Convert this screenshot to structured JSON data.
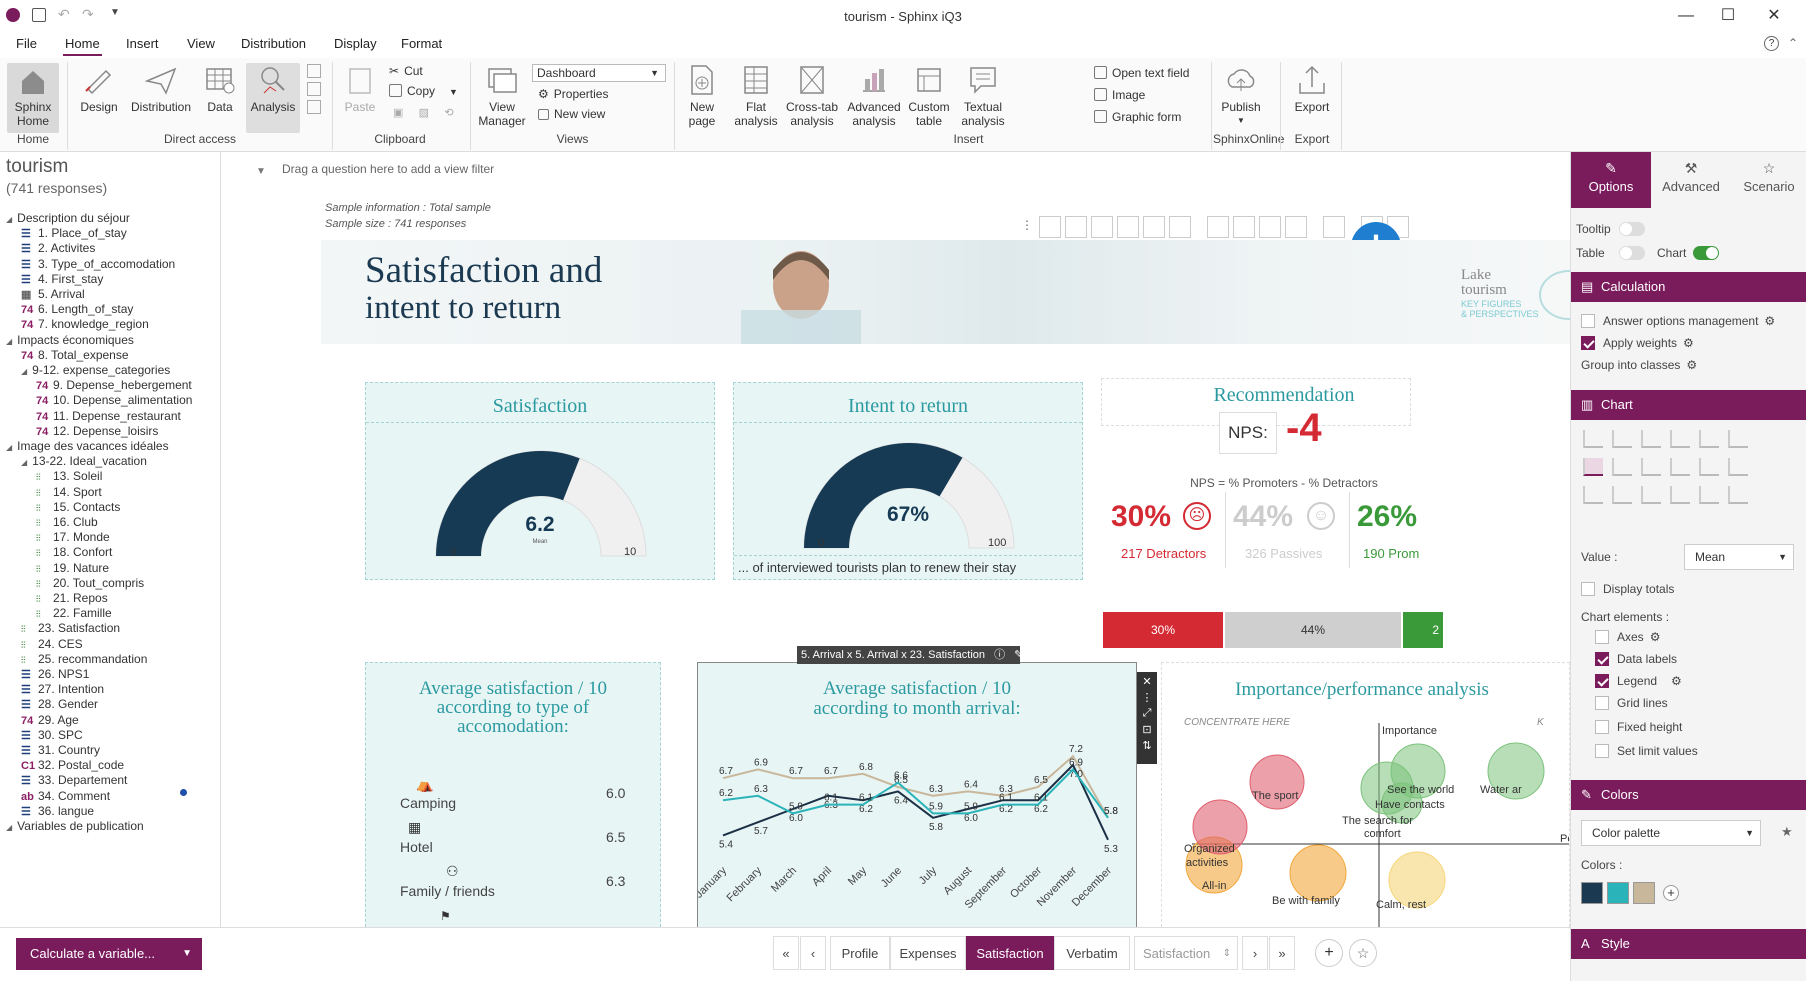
{
  "window": {
    "title": "tourism - Sphinx iQ3"
  },
  "menu": [
    "File",
    "Home",
    "Insert",
    "View",
    "Distribution",
    "Display",
    "Format"
  ],
  "ribbon": {
    "home_btn": [
      "Sphinx",
      "Home"
    ],
    "group_home": "Home",
    "design": "Design",
    "distribution": "Distribution",
    "data": "Data",
    "analysis": "Analysis",
    "group_direct": "Direct access",
    "paste": "Paste",
    "cut": "Cut",
    "copy": "Copy",
    "group_clipboard": "Clipboard",
    "view_manager": [
      "View",
      "Manager"
    ],
    "views_select": "Dashboard",
    "properties": "Properties",
    "new_view": "New view",
    "group_views": "Views",
    "new_page": [
      "New",
      "page"
    ],
    "flat": [
      "Flat",
      "analysis"
    ],
    "crosstab": [
      "Cross-tab",
      "analysis"
    ],
    "advanced": [
      "Advanced",
      "analysis"
    ],
    "custom": [
      "Custom",
      "table"
    ],
    "textual": [
      "Textual",
      "analysis"
    ],
    "open_text": "Open text field",
    "image": "Image",
    "graphic_form": "Graphic form",
    "group_insert": "Insert",
    "publish": "Publish",
    "group_sphinxonline": "SphinxOnline",
    "export": "Export",
    "group_export": "Export"
  },
  "left": {
    "survey": "tourism",
    "responses": "(741 responses)",
    "tree": [
      {
        "t": "Description du séjour",
        "lvl": 0,
        "ic": "tri"
      },
      {
        "t": "1. Place_of_stay",
        "lvl": 1,
        "ic": "list"
      },
      {
        "t": "2. Activites",
        "lvl": 1,
        "ic": "list"
      },
      {
        "t": "3. Type_of_accomodation",
        "lvl": 1,
        "ic": "list"
      },
      {
        "t": "4. First_stay",
        "lvl": 1,
        "ic": "list"
      },
      {
        "t": "5. Arrival",
        "lvl": 1,
        "ic": "cal"
      },
      {
        "t": "6. Length_of_stay",
        "lvl": 1,
        "ic": "num",
        "code": "74"
      },
      {
        "t": "7. knowledge_region",
        "lvl": 1,
        "ic": "num",
        "code": "74"
      },
      {
        "t": "Impacts économiques",
        "lvl": 0,
        "ic": "tri"
      },
      {
        "t": "8. Total_expense",
        "lvl": 1,
        "ic": "num",
        "code": "74"
      },
      {
        "t": "9-12. expense_categories",
        "lvl": 1,
        "ic": "tri"
      },
      {
        "t": "9. Depense_hebergement",
        "lvl": 2,
        "ic": "num",
        "code": "74"
      },
      {
        "t": "10. Depense_alimentation",
        "lvl": 2,
        "ic": "num",
        "code": "74"
      },
      {
        "t": "11. Depense_restaurant",
        "lvl": 2,
        "ic": "num",
        "code": "74"
      },
      {
        "t": "12. Depense_loisirs",
        "lvl": 2,
        "ic": "num",
        "code": "74"
      },
      {
        "t": "Image des vacances idéales",
        "lvl": 0,
        "ic": "tri"
      },
      {
        "t": "13-22. Ideal_vacation",
        "lvl": 1,
        "ic": "tri"
      },
      {
        "t": "13. Soleil",
        "lvl": 2,
        "ic": "scale"
      },
      {
        "t": "14. Sport",
        "lvl": 2,
        "ic": "scale"
      },
      {
        "t": "15. Contacts",
        "lvl": 2,
        "ic": "scale"
      },
      {
        "t": "16. Club",
        "lvl": 2,
        "ic": "scale"
      },
      {
        "t": "17. Monde",
        "lvl": 2,
        "ic": "scale"
      },
      {
        "t": "18. Confort",
        "lvl": 2,
        "ic": "scale"
      },
      {
        "t": "19. Nature",
        "lvl": 2,
        "ic": "scale"
      },
      {
        "t": "20. Tout_compris",
        "lvl": 2,
        "ic": "scale"
      },
      {
        "t": "21. Repos",
        "lvl": 2,
        "ic": "scale"
      },
      {
        "t": "22. Famille",
        "lvl": 2,
        "ic": "scale"
      },
      {
        "t": "23. Satisfaction",
        "lvl": 1,
        "ic": "scale"
      },
      {
        "t": "24. CES",
        "lvl": 1,
        "ic": "scale"
      },
      {
        "t": "25. recommandation",
        "lvl": 1,
        "ic": "scale"
      },
      {
        "t": "26. NPS1",
        "lvl": 1,
        "ic": "list"
      },
      {
        "t": "27. Intention",
        "lvl": 1,
        "ic": "list"
      },
      {
        "t": "28. Gender",
        "lvl": 1,
        "ic": "list"
      },
      {
        "t": "29. Age",
        "lvl": 1,
        "ic": "num",
        "code": "74"
      },
      {
        "t": "30. SPC",
        "lvl": 1,
        "ic": "list"
      },
      {
        "t": "31. Country",
        "lvl": 1,
        "ic": "list"
      },
      {
        "t": "32. Postal_code",
        "lvl": 1,
        "ic": "num",
        "code": "C1"
      },
      {
        "t": "33. Departement",
        "lvl": 1,
        "ic": "list"
      },
      {
        "t": "34. Comment",
        "lvl": 1,
        "ic": "num",
        "code": "ab"
      },
      {
        "t": "36. langue",
        "lvl": 1,
        "ic": "list"
      },
      {
        "t": "Variables de publication",
        "lvl": 0,
        "ic": "tri"
      }
    ],
    "calc_button": "Calculate a variable..."
  },
  "main": {
    "filter_hint": "Drag a question here to add a view filter",
    "sample_info_label": "Sample information : ",
    "sample_info_value": "Total sample",
    "sample_size": "Sample size : 741 responses",
    "banner_title_1": "Satisfaction and",
    "banner_title_2": "intent to return",
    "banner_logo_1": "Lake",
    "banner_logo_2": "tourism",
    "banner_logo_3": "KEY FIGURES",
    "banner_logo_4": "& PERSPECTIVES",
    "sat_title": "Satisfaction",
    "sat_value": "6.2",
    "sat_sub": "Mean",
    "sat_min": "0",
    "sat_max": "10",
    "sat_fraction": 0.62,
    "int_title": "Intent to return",
    "int_value": "67%",
    "int_min": "0",
    "int_max": "100",
    "int_fraction": 0.67,
    "int_caption": "... of interviewed tourists plan to renew their stay",
    "rec_title": "Recommendation",
    "nps_label": "NPS:",
    "nps_value": "-4",
    "nps_formula": "NPS = % Promoters - % Detractors",
    "detractors_pct": "30%",
    "detractors_label": "217 Detractors",
    "passives_pct": "44%",
    "passives_label": "326 Passives",
    "promoters_pct": "26%",
    "promoters_label": "190 Prom",
    "bar_det": "30%",
    "bar_pas": "44%",
    "bar_pro": "2",
    "acc_title": "Average satisfaction / 10 according to type of accomodation:",
    "acc_rows": [
      {
        "label": "Camping",
        "value": "6.0"
      },
      {
        "label": "Hotel",
        "value": "6.5"
      },
      {
        "label": "Family / friends",
        "value": "6.3"
      }
    ],
    "month_tooltip": "5. Arrival x 5. Arrival x 23. Satisfaction",
    "month_title_1": "Average satisfaction / 10",
    "month_title_2": "according to month arrival:",
    "imp_title": "Importance/performance analysis",
    "imp_concentrate": "CONCENTRATE HERE",
    "imp_k": "K",
    "imp_axis": "Importance",
    "imp_per": "Per",
    "bubbles": [
      {
        "label": "The sport",
        "color": "#e06070"
      },
      {
        "label": "See the world",
        "color": "#7cc27c"
      },
      {
        "label": "Have contacts",
        "color": "#7cc27c"
      },
      {
        "label": "Water ar",
        "color": "#7cc27c"
      },
      {
        "label": "The search for",
        "color": ""
      },
      {
        "label": "comfort",
        "color": ""
      },
      {
        "label": "Organized",
        "color": "#f2a73b"
      },
      {
        "label": "activities",
        "color": "#f2a73b"
      },
      {
        "label": "All-in",
        "color": "#e06070"
      },
      {
        "label": "Be with family",
        "color": "#f2a73b"
      },
      {
        "label": "Calm, rest",
        "color": "#f5d67a"
      }
    ]
  },
  "chart_data": {
    "type": "line",
    "title": "Average satisfaction / 10 according to month arrival:",
    "categories": [
      "January",
      "February",
      "March",
      "April",
      "May",
      "June",
      "July",
      "August",
      "September",
      "October",
      "November",
      "December"
    ],
    "series": [
      {
        "values": [
          6.7,
          6.9,
          6.7,
          6.7,
          6.8,
          6.5,
          6.3,
          6.4,
          6.3,
          6.5,
          7.2,
          5.8
        ],
        "color": "#c8b79a"
      },
      {
        "values": [
          5.4,
          5.7,
          6.0,
          6.3,
          6.2,
          6.4,
          5.8,
          6.0,
          6.2,
          6.2,
          7.0,
          5.3
        ],
        "color": "#1b2f45"
      },
      {
        "values": [
          6.2,
          6.3,
          5.9,
          6.1,
          6.1,
          6.6,
          5.9,
          5.9,
          6.1,
          6.1,
          6.9,
          5.8
        ],
        "color": "#2ab3b8"
      }
    ],
    "ylim": [
      5.0,
      7.5
    ]
  },
  "bottom": {
    "tabs": [
      "Profile",
      "Expenses",
      "Satisfaction",
      "Verbatim"
    ],
    "active_tab": "Satisfaction",
    "select_value": "Satisfaction",
    "nav_first": "«",
    "nav_prev": "‹",
    "nav_next": "›",
    "nav_last": "»"
  },
  "right": {
    "tabs": [
      "Options",
      "Advanced",
      "Scenario"
    ],
    "tooltip": "Tooltip",
    "table": "Table",
    "chart": "Chart",
    "calc_head": "Calculation",
    "answer_opts": "Answer options management",
    "apply_weights": "Apply weights",
    "group_classes": "Group into classes",
    "chart_head": "Chart",
    "value_label": "Value :",
    "value_select": "Mean",
    "display_totals": "Display totals",
    "chart_elements": "Chart elements :",
    "axes": "Axes",
    "data_labels": "Data labels",
    "legend": "Legend",
    "grid_lines": "Grid lines",
    "fixed_height": "Fixed height",
    "set_limits": "Set limit values",
    "colors_head": "Colors",
    "palette": "Color palette",
    "colors_label": "Colors :",
    "swatches": [
      "#1b3a52",
      "#2ab3b8",
      "#c8b79a"
    ],
    "style_head": "Style"
  },
  "colors": {
    "accent": "#7a1b5c",
    "teal": "#2b9aa0",
    "navy": "#163a54",
    "red": "#d42a33",
    "green": "#3a9a3a"
  }
}
